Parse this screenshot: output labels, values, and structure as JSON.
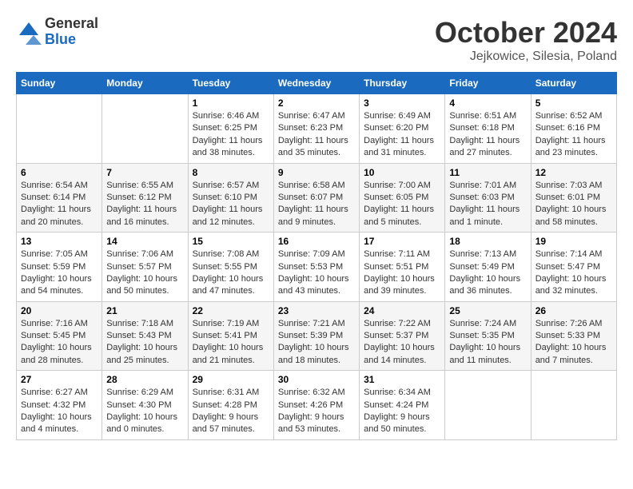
{
  "header": {
    "logo_general": "General",
    "logo_blue": "Blue",
    "month_title": "October 2024",
    "location": "Jejkowice, Silesia, Poland"
  },
  "calendar": {
    "days_of_week": [
      "Sunday",
      "Monday",
      "Tuesday",
      "Wednesday",
      "Thursday",
      "Friday",
      "Saturday"
    ],
    "weeks": [
      [
        {
          "day": "",
          "info": ""
        },
        {
          "day": "",
          "info": ""
        },
        {
          "day": "1",
          "info": "Sunrise: 6:46 AM\nSunset: 6:25 PM\nDaylight: 11 hours\nand 38 minutes."
        },
        {
          "day": "2",
          "info": "Sunrise: 6:47 AM\nSunset: 6:23 PM\nDaylight: 11 hours\nand 35 minutes."
        },
        {
          "day": "3",
          "info": "Sunrise: 6:49 AM\nSunset: 6:20 PM\nDaylight: 11 hours\nand 31 minutes."
        },
        {
          "day": "4",
          "info": "Sunrise: 6:51 AM\nSunset: 6:18 PM\nDaylight: 11 hours\nand 27 minutes."
        },
        {
          "day": "5",
          "info": "Sunrise: 6:52 AM\nSunset: 6:16 PM\nDaylight: 11 hours\nand 23 minutes."
        }
      ],
      [
        {
          "day": "6",
          "info": "Sunrise: 6:54 AM\nSunset: 6:14 PM\nDaylight: 11 hours\nand 20 minutes."
        },
        {
          "day": "7",
          "info": "Sunrise: 6:55 AM\nSunset: 6:12 PM\nDaylight: 11 hours\nand 16 minutes."
        },
        {
          "day": "8",
          "info": "Sunrise: 6:57 AM\nSunset: 6:10 PM\nDaylight: 11 hours\nand 12 minutes."
        },
        {
          "day": "9",
          "info": "Sunrise: 6:58 AM\nSunset: 6:07 PM\nDaylight: 11 hours\nand 9 minutes."
        },
        {
          "day": "10",
          "info": "Sunrise: 7:00 AM\nSunset: 6:05 PM\nDaylight: 11 hours\nand 5 minutes."
        },
        {
          "day": "11",
          "info": "Sunrise: 7:01 AM\nSunset: 6:03 PM\nDaylight: 11 hours\nand 1 minute."
        },
        {
          "day": "12",
          "info": "Sunrise: 7:03 AM\nSunset: 6:01 PM\nDaylight: 10 hours\nand 58 minutes."
        }
      ],
      [
        {
          "day": "13",
          "info": "Sunrise: 7:05 AM\nSunset: 5:59 PM\nDaylight: 10 hours\nand 54 minutes."
        },
        {
          "day": "14",
          "info": "Sunrise: 7:06 AM\nSunset: 5:57 PM\nDaylight: 10 hours\nand 50 minutes."
        },
        {
          "day": "15",
          "info": "Sunrise: 7:08 AM\nSunset: 5:55 PM\nDaylight: 10 hours\nand 47 minutes."
        },
        {
          "day": "16",
          "info": "Sunrise: 7:09 AM\nSunset: 5:53 PM\nDaylight: 10 hours\nand 43 minutes."
        },
        {
          "day": "17",
          "info": "Sunrise: 7:11 AM\nSunset: 5:51 PM\nDaylight: 10 hours\nand 39 minutes."
        },
        {
          "day": "18",
          "info": "Sunrise: 7:13 AM\nSunset: 5:49 PM\nDaylight: 10 hours\nand 36 minutes."
        },
        {
          "day": "19",
          "info": "Sunrise: 7:14 AM\nSunset: 5:47 PM\nDaylight: 10 hours\nand 32 minutes."
        }
      ],
      [
        {
          "day": "20",
          "info": "Sunrise: 7:16 AM\nSunset: 5:45 PM\nDaylight: 10 hours\nand 28 minutes."
        },
        {
          "day": "21",
          "info": "Sunrise: 7:18 AM\nSunset: 5:43 PM\nDaylight: 10 hours\nand 25 minutes."
        },
        {
          "day": "22",
          "info": "Sunrise: 7:19 AM\nSunset: 5:41 PM\nDaylight: 10 hours\nand 21 minutes."
        },
        {
          "day": "23",
          "info": "Sunrise: 7:21 AM\nSunset: 5:39 PM\nDaylight: 10 hours\nand 18 minutes."
        },
        {
          "day": "24",
          "info": "Sunrise: 7:22 AM\nSunset: 5:37 PM\nDaylight: 10 hours\nand 14 minutes."
        },
        {
          "day": "25",
          "info": "Sunrise: 7:24 AM\nSunset: 5:35 PM\nDaylight: 10 hours\nand 11 minutes."
        },
        {
          "day": "26",
          "info": "Sunrise: 7:26 AM\nSunset: 5:33 PM\nDaylight: 10 hours\nand 7 minutes."
        }
      ],
      [
        {
          "day": "27",
          "info": "Sunrise: 6:27 AM\nSunset: 4:32 PM\nDaylight: 10 hours\nand 4 minutes."
        },
        {
          "day": "28",
          "info": "Sunrise: 6:29 AM\nSunset: 4:30 PM\nDaylight: 10 hours\nand 0 minutes."
        },
        {
          "day": "29",
          "info": "Sunrise: 6:31 AM\nSunset: 4:28 PM\nDaylight: 9 hours\nand 57 minutes."
        },
        {
          "day": "30",
          "info": "Sunrise: 6:32 AM\nSunset: 4:26 PM\nDaylight: 9 hours\nand 53 minutes."
        },
        {
          "day": "31",
          "info": "Sunrise: 6:34 AM\nSunset: 4:24 PM\nDaylight: 9 hours\nand 50 minutes."
        },
        {
          "day": "",
          "info": ""
        },
        {
          "day": "",
          "info": ""
        }
      ]
    ]
  }
}
